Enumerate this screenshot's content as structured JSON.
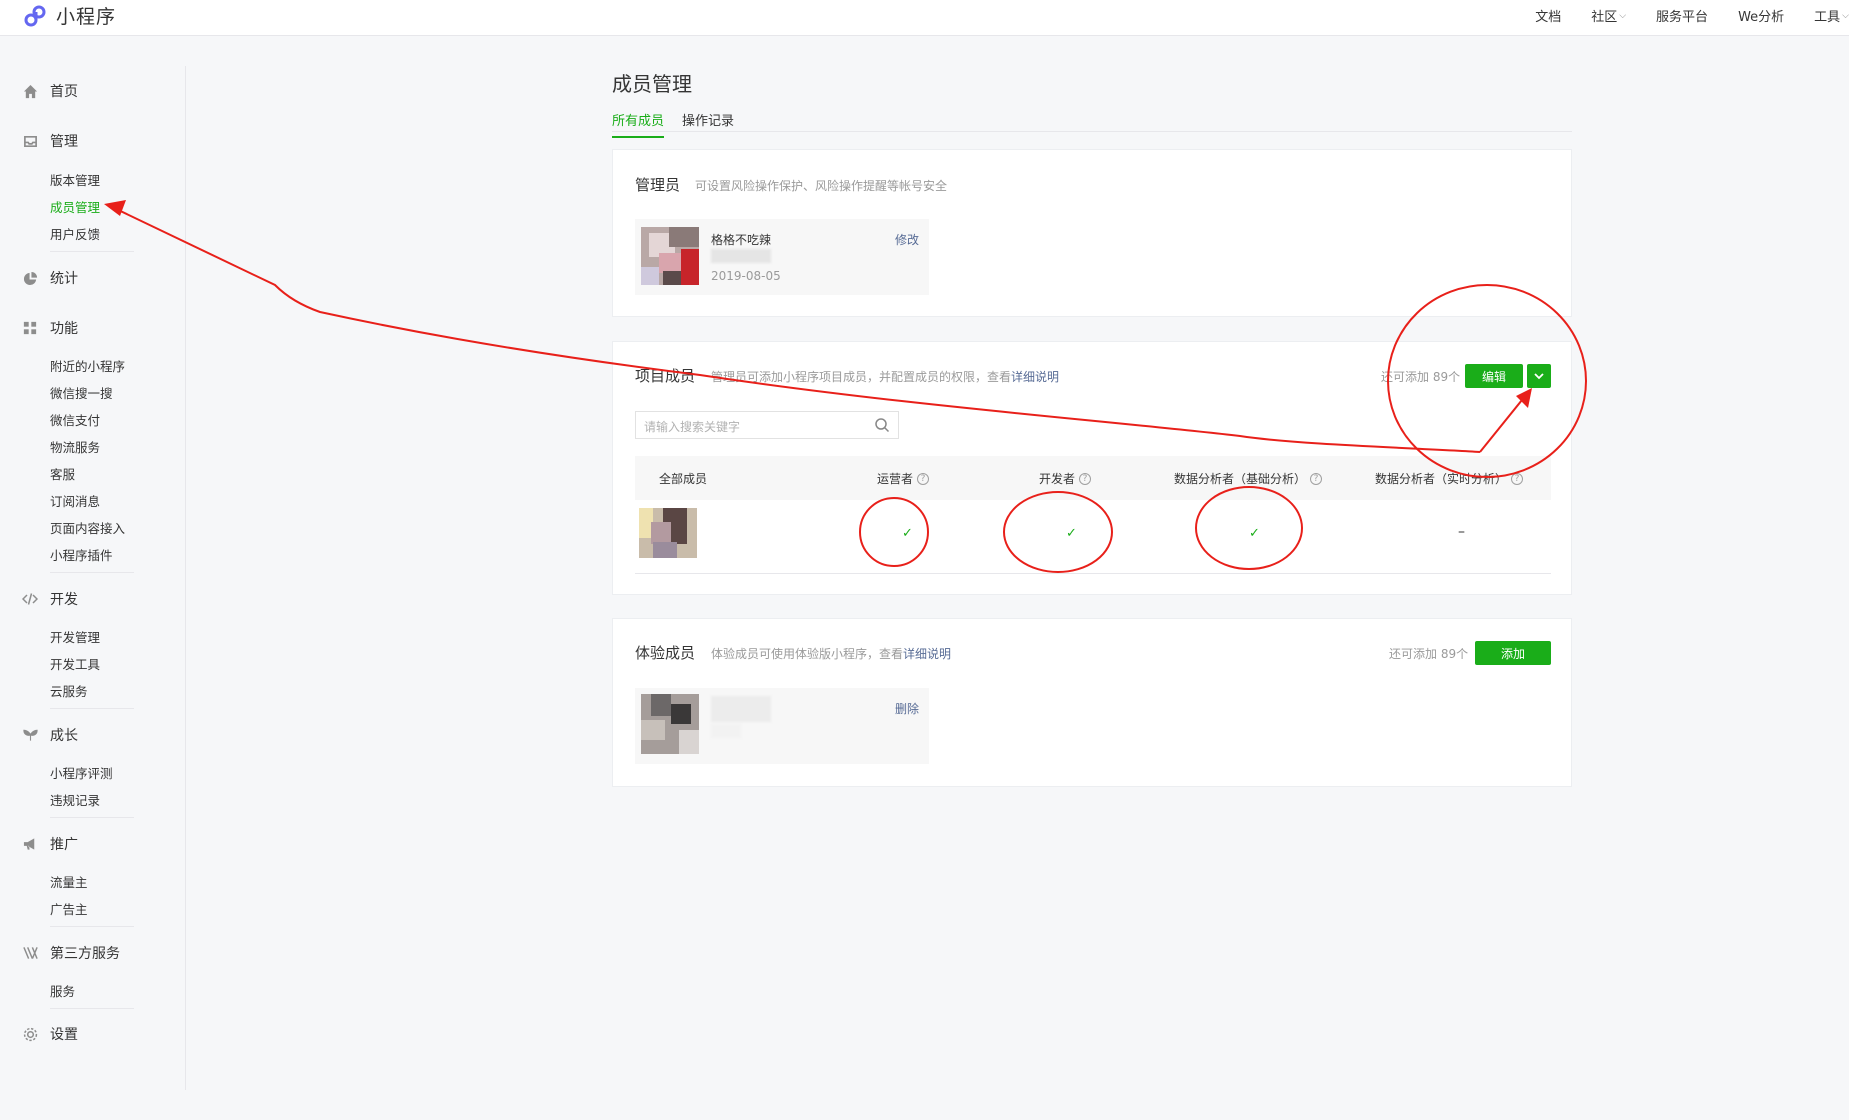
{
  "topbar": {
    "app_name": "小程序",
    "nav": [
      {
        "label": "文档",
        "dropdown": false
      },
      {
        "label": "社区",
        "dropdown": true
      },
      {
        "label": "服务平台",
        "dropdown": false
      },
      {
        "label": "We分析",
        "dropdown": false
      },
      {
        "label": "工具",
        "dropdown": true
      }
    ]
  },
  "sidebar": {
    "home": {
      "label": "首页",
      "icon": "home-icon"
    },
    "manage": {
      "label": "管理",
      "icon": "inbox-icon",
      "items": [
        "版本管理",
        "成员管理",
        "用户反馈"
      ],
      "active_index": 1
    },
    "stats": {
      "label": "统计",
      "icon": "pie-chart-icon"
    },
    "features": {
      "label": "功能",
      "icon": "grid-icon",
      "items": [
        "附近的小程序",
        "微信搜一搜",
        "微信支付",
        "物流服务",
        "客服",
        "订阅消息",
        "页面内容接入",
        "小程序插件"
      ]
    },
    "dev": {
      "label": "开发",
      "icon": "code-icon",
      "items": [
        "开发管理",
        "开发工具",
        "云服务"
      ]
    },
    "growth": {
      "label": "成长",
      "icon": "sprout-icon",
      "items": [
        "小程序评测",
        "违规记录"
      ]
    },
    "promote": {
      "label": "推广",
      "icon": "megaphone-icon",
      "items": [
        "流量主",
        "广告主"
      ]
    },
    "third_party": {
      "label": "第三方服务",
      "icon": "third-party-icon",
      "items": [
        "服务"
      ]
    },
    "settings": {
      "label": "设置",
      "icon": "gear-icon"
    }
  },
  "main": {
    "title": "成员管理",
    "tabs": [
      "所有成员",
      "操作记录"
    ],
    "active_tab": 0,
    "admin": {
      "title": "管理员",
      "desc": "可设置风险操作保护、风险操作提醒等帐号安全",
      "member": {
        "name": "格格不吃辣",
        "date": "2019-08-05",
        "action": "修改"
      }
    },
    "project": {
      "title": "项目成员",
      "desc": "管理员可添加小程序项目成员，并配置成员的权限，查看",
      "desc_link": "详细说明",
      "remain": "还可添加 89个",
      "edit_button": "编辑",
      "dropdown_icon": "chevron-down-icon",
      "search_placeholder": "请输入搜索关键字",
      "columns": [
        "全部成员",
        "运营者",
        "开发者",
        "数据分析者（基础分析）",
        "数据分析者（实时分析）"
      ],
      "rows": [
        {
          "operator": "✓",
          "developer": "✓",
          "analyst_basic": "✓",
          "analyst_realtime": "–"
        }
      ]
    },
    "experience": {
      "title": "体验成员",
      "desc": "体验成员可使用体验版小程序，查看",
      "desc_link": "详细说明",
      "remain": "还可添加 89个",
      "add_button": "添加",
      "member": {
        "action": "删除"
      }
    }
  },
  "colors": {
    "accent": "#1aad19",
    "link": "#576b95",
    "annotation": "#e8201a"
  }
}
